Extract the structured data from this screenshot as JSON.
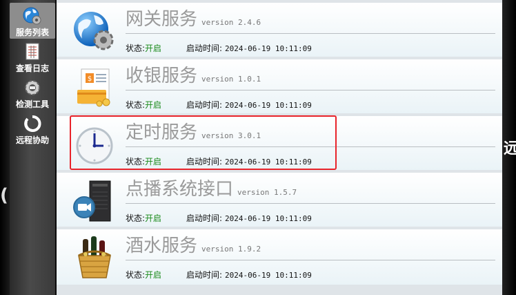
{
  "sidebar": {
    "items": [
      {
        "label": "服务列表",
        "icon": "globe-gear-icon",
        "active": true
      },
      {
        "label": "查看日志",
        "icon": "log-sheet-icon",
        "active": false
      },
      {
        "label": "检测工具",
        "icon": "tools-gear-icon",
        "active": false
      },
      {
        "label": "远程协助",
        "icon": "refresh-icon",
        "active": false
      }
    ]
  },
  "services": [
    {
      "name": "网关服务",
      "version": "version 2.4.6",
      "status_label": "状态:",
      "status_value": "开启",
      "start_label": "启动时间:",
      "start_time": "2024-06-19 10:11:09",
      "icon": "globe-gear-icon"
    },
    {
      "name": "收银服务",
      "version": "version 1.0.1",
      "status_label": "状态:",
      "status_value": "开启",
      "start_label": "启动时间:",
      "start_time": "2024-06-19 10:11:09",
      "icon": "pay-card-icon"
    },
    {
      "name": "定时服务",
      "version": "version 3.0.1",
      "status_label": "状态:",
      "status_value": "开启",
      "start_label": "启动时间:",
      "start_time": "2024-06-19 10:11:09",
      "icon": "clock-icon"
    },
    {
      "name": "点播系统接口",
      "version": "version 1.5.7",
      "status_label": "状态:",
      "status_value": "开启",
      "start_label": "启动时间:",
      "start_time": "2024-06-19 10:11:09",
      "icon": "server-camera-icon"
    },
    {
      "name": "酒水服务",
      "version": "version 1.9.2",
      "status_label": "状态:",
      "status_value": "开启",
      "start_label": "启动时间:",
      "start_time": "2024-06-19 10:11:09",
      "icon": "wine-basket-icon"
    }
  ],
  "edge": {
    "right_glyph": "远",
    "left_glyph": "("
  },
  "colors": {
    "status_on": "#1a8a1a",
    "highlight": "#e8232a",
    "name_text": "#9a9a9a"
  }
}
